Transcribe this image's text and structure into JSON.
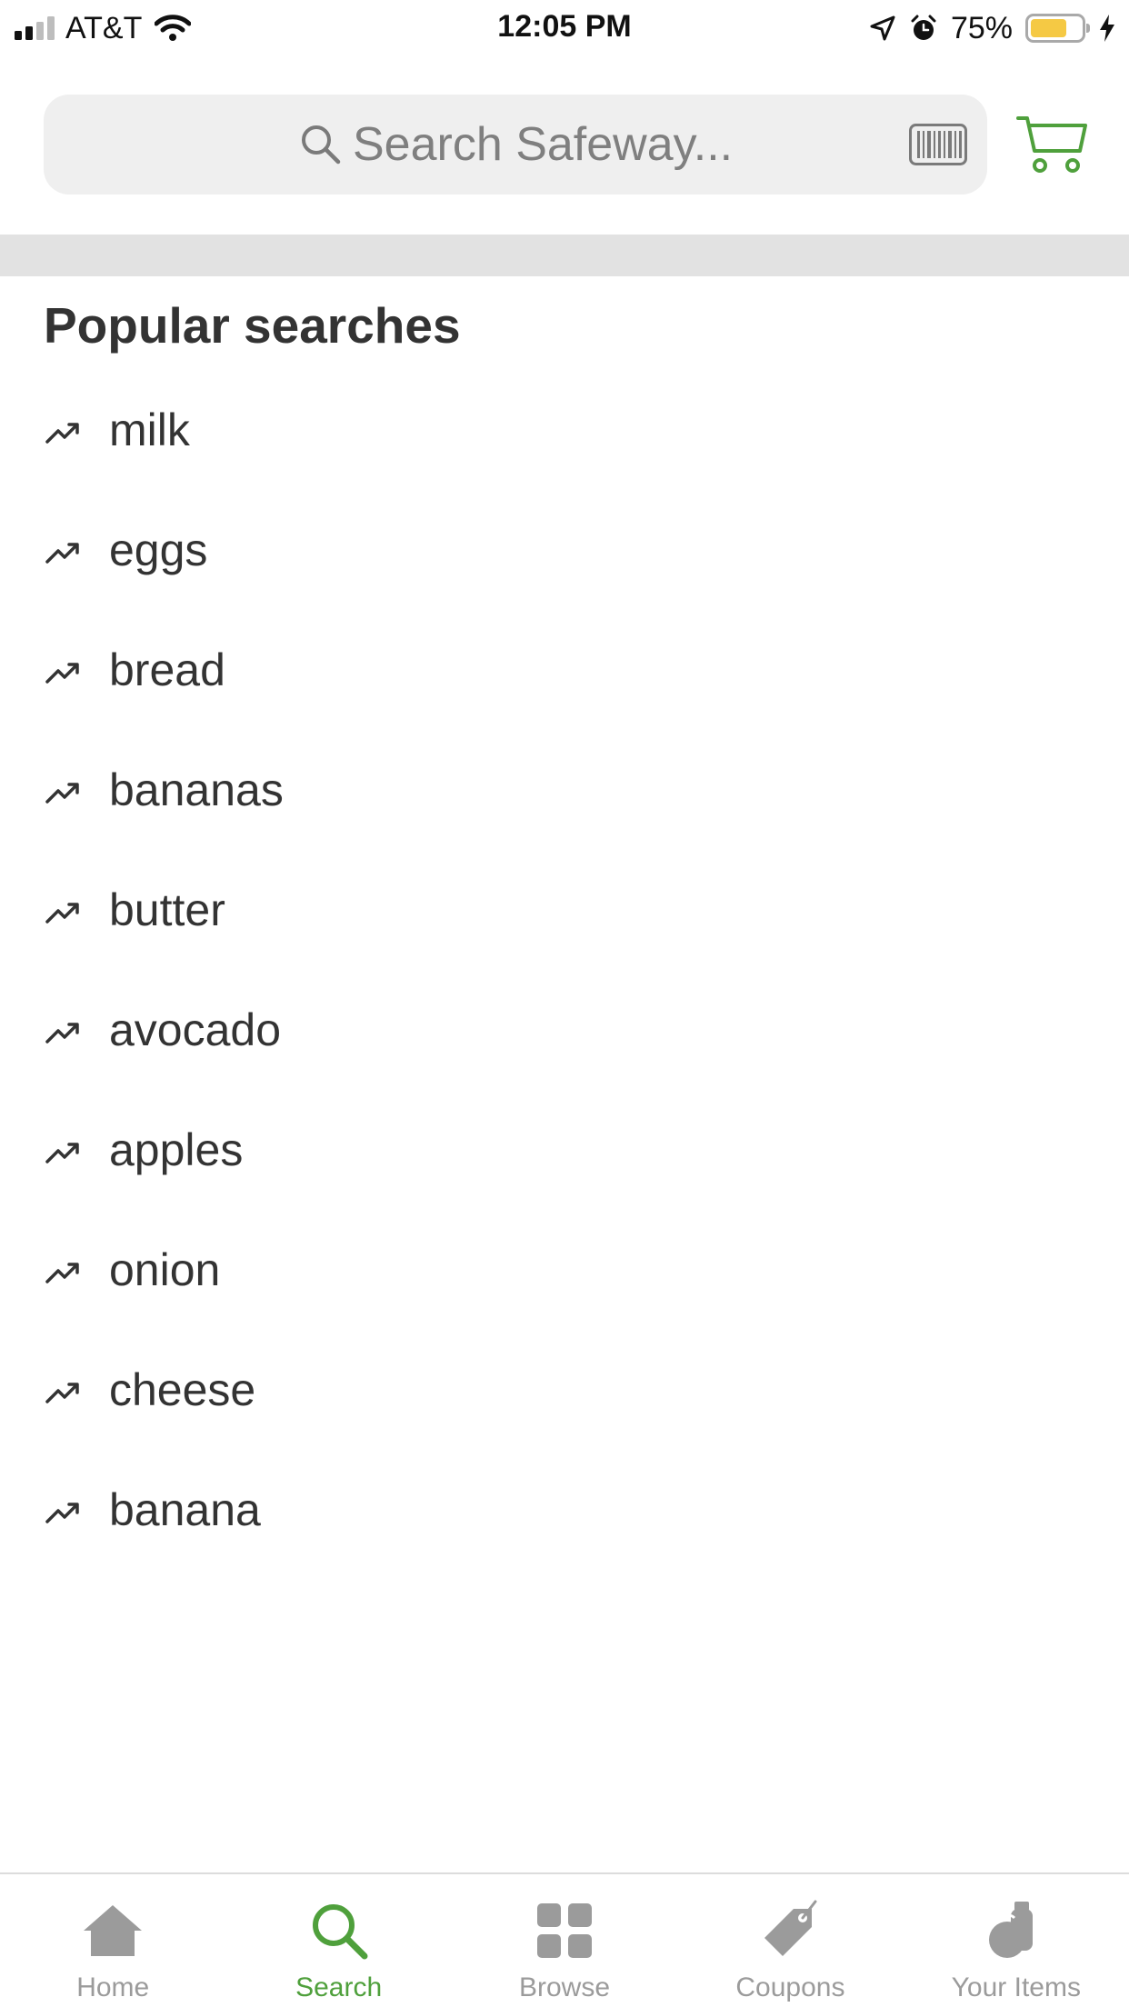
{
  "status_bar": {
    "carrier": "AT&T",
    "time": "12:05 PM",
    "battery_percent": "75%",
    "battery_level": 0.75,
    "signal_bars_active": 2,
    "signal_bars_total": 4
  },
  "header": {
    "search_placeholder": "Search Safeway...",
    "search_value": ""
  },
  "popular": {
    "title": "Popular searches",
    "items": [
      {
        "label": "milk"
      },
      {
        "label": "eggs"
      },
      {
        "label": "bread"
      },
      {
        "label": "bananas"
      },
      {
        "label": "butter"
      },
      {
        "label": "avocado"
      },
      {
        "label": "apples"
      },
      {
        "label": "onion"
      },
      {
        "label": "cheese"
      },
      {
        "label": "banana"
      }
    ]
  },
  "tabs": [
    {
      "label": "Home",
      "icon": "home-icon",
      "active": false
    },
    {
      "label": "Search",
      "icon": "search-icon",
      "active": true
    },
    {
      "label": "Browse",
      "icon": "grid-icon",
      "active": false
    },
    {
      "label": "Coupons",
      "icon": "tag-icon",
      "active": false
    },
    {
      "label": "Your Items",
      "icon": "apple-icon",
      "active": false
    }
  ],
  "colors": {
    "accent": "#4fa03c",
    "inactive": "#9b9b9b",
    "text": "#333333",
    "search_bg": "#efefef",
    "band": "#e2e2e2",
    "battery": "#f5c944"
  }
}
